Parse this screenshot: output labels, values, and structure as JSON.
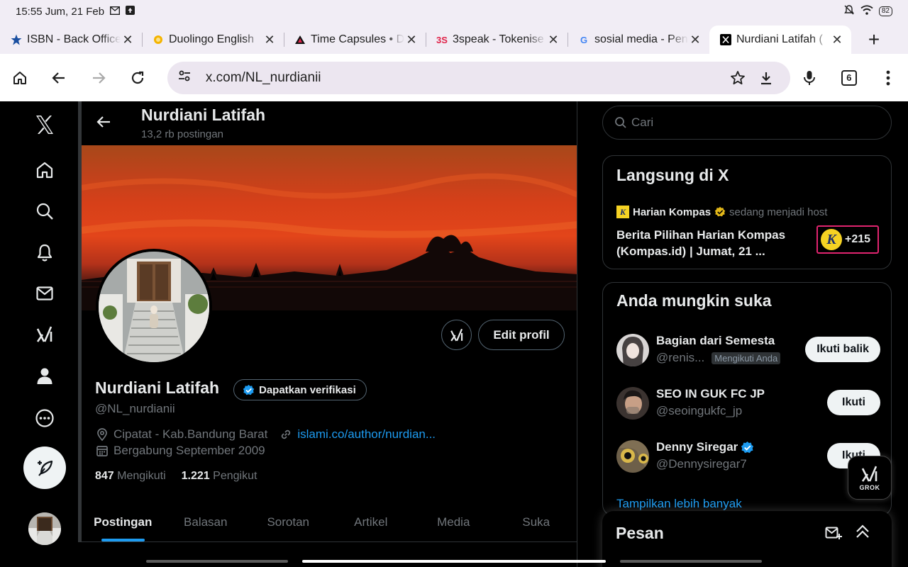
{
  "status_bar": {
    "time_date": "15:55 Jum, 21 Feb",
    "battery": "82"
  },
  "browser": {
    "tabs": [
      {
        "label": "ISBN - Back Office",
        "favicon": "star-icon",
        "color": "#1a4fa0"
      },
      {
        "label": "Duolingo English",
        "favicon": "duolingo-icon",
        "color": "#f4b400"
      },
      {
        "label": "Time Capsules • D",
        "favicon": "time-capsule-icon",
        "color": "#000000"
      },
      {
        "label": "3speak - Tokenise",
        "favicon": "3speak-icon",
        "color": "#e0244a"
      },
      {
        "label": "sosial media - Pen",
        "favicon": "google-icon",
        "color": "#4285f4"
      },
      {
        "label": "Nurdiani Latifah (",
        "favicon": "x-icon",
        "color": "#000000",
        "active": true
      }
    ],
    "url": "x.com/NL_nurdianii",
    "tab_count": "6"
  },
  "profile_header": {
    "name": "Nurdiani Latifah",
    "post_count": "13,2 rb postingan"
  },
  "profile": {
    "name": "Nurdiani Latifah",
    "verify_label": "Dapatkan verifikasi",
    "handle": "@NL_nurdianii",
    "location": "Cipatat - Kab.Bandung Barat",
    "website": "islami.co/author/nurdian...",
    "joined": "Bergabung September 2009",
    "following_count": "847",
    "following_label": "Mengikuti",
    "followers_count": "1.221",
    "followers_label": "Pengikut",
    "edit_button": "Edit profil"
  },
  "profile_tabs": [
    "Postingan",
    "Balasan",
    "Sorotan",
    "Artikel",
    "Media",
    "Suka"
  ],
  "search": {
    "placeholder": "Cari"
  },
  "live": {
    "title": "Langsung di X",
    "host_name": "Harian Kompas",
    "host_status": "sedang menjadi host",
    "space_title": "Berita Pilihan Harian Kompas (Kompas.id) | Jumat, 21 ...",
    "listener_count": "+215",
    "brand_color": "#f5d223"
  },
  "suggestions": {
    "title": "Anda mungkin suka",
    "items": [
      {
        "name": "Bagian dari Semesta",
        "handle": "@renis...",
        "badge": "Mengikuti Anda",
        "button": "Ikuti balik",
        "verified": false
      },
      {
        "name": "SEO IN GUK FC JP",
        "handle": "@seoingukfc_jp",
        "badge": "",
        "button": "Ikuti",
        "verified": false
      },
      {
        "name": "Denny Siregar",
        "handle": "@Dennysiregar7",
        "badge": "",
        "button": "Ikuti",
        "verified": true
      }
    ],
    "show_more": "Tampilkan lebih banyak"
  },
  "messages": {
    "title": "Pesan"
  },
  "grok": {
    "label": "GROK"
  },
  "colors": {
    "accent": "#1d9bf0",
    "background": "#000000",
    "live_border": "#e0246f"
  }
}
